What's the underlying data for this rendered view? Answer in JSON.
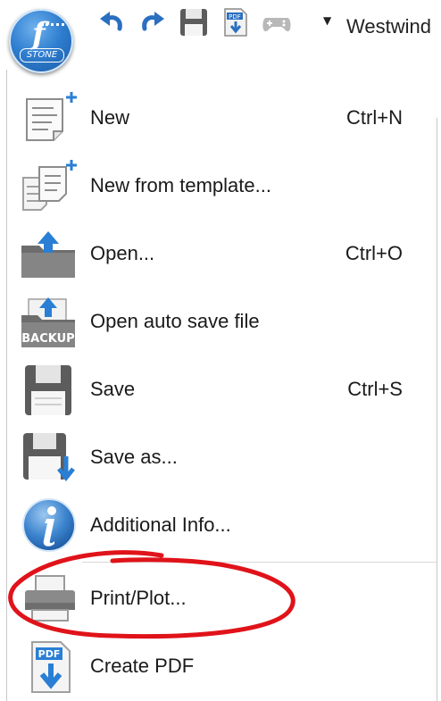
{
  "toolbar": {
    "app_button_logo": "STONE",
    "quick_access": [
      {
        "icon": "undo-icon"
      },
      {
        "icon": "redo-icon"
      },
      {
        "icon": "save-icon"
      },
      {
        "icon": "pdf-export-icon"
      },
      {
        "icon": "gamepad-icon"
      }
    ],
    "profile_label": "Westwind"
  },
  "menu": {
    "items": [
      {
        "label": "New",
        "shortcut": "Ctrl+N",
        "icon": "new-document-icon"
      },
      {
        "label": "New from template...",
        "shortcut": "",
        "icon": "new-from-template-icon"
      },
      {
        "label": "Open...",
        "shortcut": "Ctrl+O",
        "icon": "open-folder-icon"
      },
      {
        "label": "Open auto save file",
        "shortcut": "",
        "icon": "backup-folder-icon",
        "badge": "BACKUP"
      },
      {
        "label": "Save",
        "shortcut": "Ctrl+S",
        "icon": "save-disk-icon"
      },
      {
        "label": "Save as...",
        "shortcut": "",
        "icon": "save-as-icon"
      },
      {
        "label": "Additional Info...",
        "shortcut": "",
        "icon": "info-icon"
      },
      {
        "label": "Print/Plot...",
        "shortcut": "",
        "icon": "printer-icon"
      },
      {
        "label": "Create PDF",
        "shortcut": "",
        "icon": "create-pdf-icon",
        "badge": "PDF"
      }
    ]
  },
  "colors": {
    "accent_blue": "#2f7ed0",
    "annotation_red": "#e0131a",
    "disk_gray": "#5c5c5c"
  }
}
